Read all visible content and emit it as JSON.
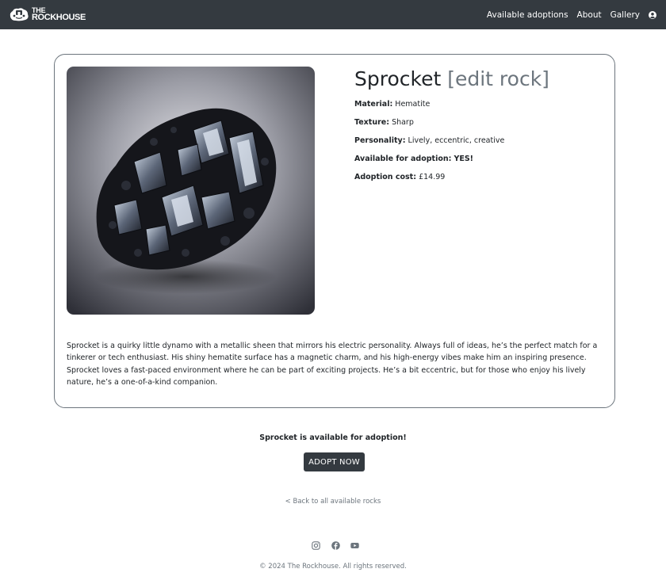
{
  "navbar": {
    "brand_line1": "THE",
    "brand_line2": "ROCKHOUSE",
    "links": [
      "Available adoptions",
      "About",
      "Gallery"
    ]
  },
  "rock": {
    "name": "Sprocket",
    "edit_label": "[edit rock]",
    "attributes": [
      {
        "label": "Material:",
        "value": "Hematite"
      },
      {
        "label": "Texture:",
        "value": "Sharp"
      },
      {
        "label": "Personality:",
        "value": "Lively, eccentric, creative"
      },
      {
        "label": "Available for adoption:",
        "value": "YES!"
      },
      {
        "label": "Adoption cost:",
        "value": "£14.99"
      }
    ],
    "description": "Sprocket is a quirky little dynamo with a metallic sheen that mirrors his electric personality. Always full of ideas, he’s the perfect match for a tinkerer or tech enthusiast. His shiny hematite surface has a magnetic charm, and his high-energy vibes make him an inspiring presence. Sprocket loves a fast-paced environment where he can be part of exciting projects. He’s a bit eccentric, but for those who enjoy his lively nature, he’s a one-of-a-kind companion."
  },
  "adoption": {
    "status_text": "Sprocket is available for adoption!",
    "button_label": "ADOPT NOW",
    "back_link": "< Back to all available rocks"
  },
  "footer": {
    "social_icons": [
      "instagram-icon",
      "facebook-icon",
      "youtube-icon"
    ],
    "copyright": "© 2024 The Rockhouse. All rights reserved."
  },
  "colors": {
    "navbar_bg": "#343a40",
    "button_bg": "#343a40",
    "muted": "#6c757d"
  }
}
